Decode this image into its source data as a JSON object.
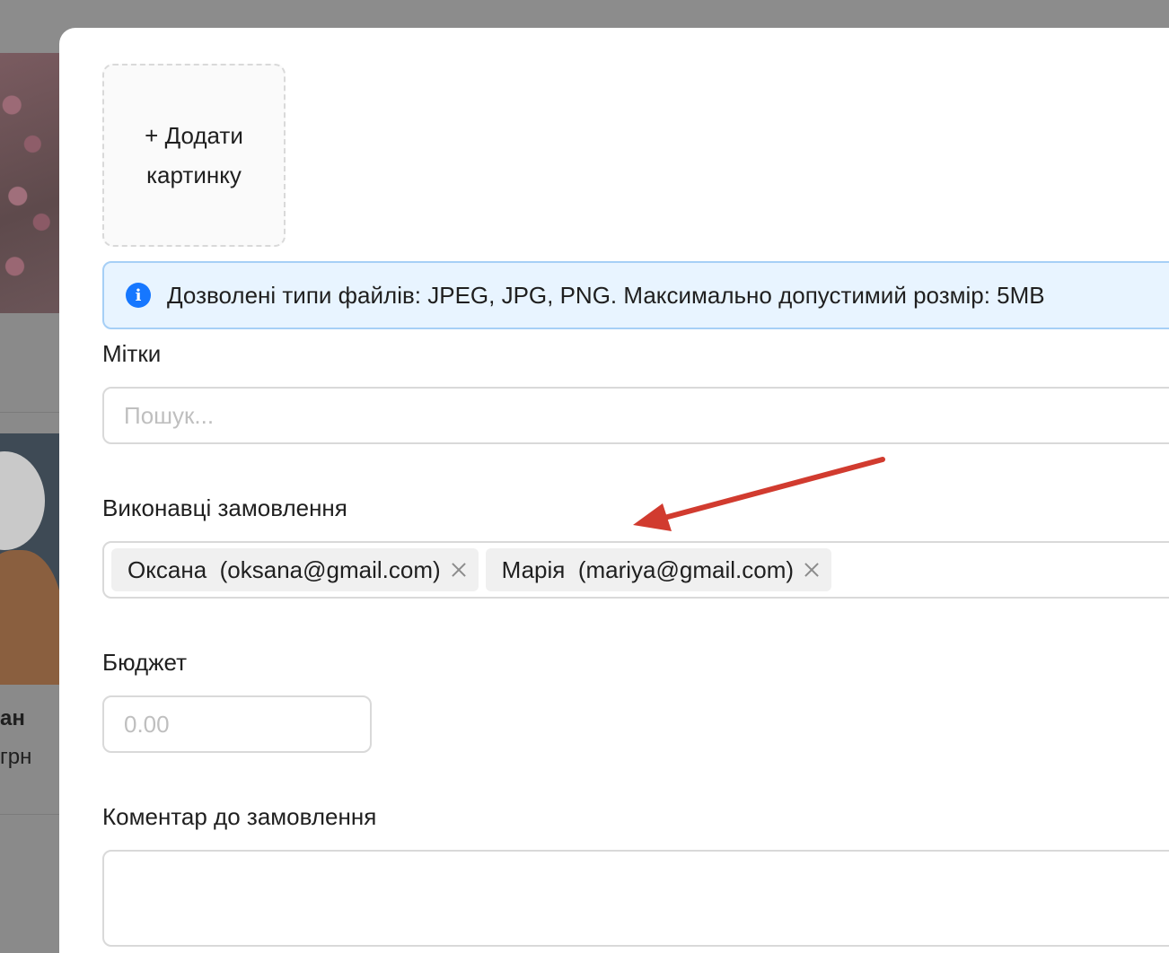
{
  "background": {
    "card_title": "ан",
    "card_price": "грн"
  },
  "upload": {
    "label": "+ Додати картинку"
  },
  "info_alert": {
    "icon": "info-icon",
    "icon_glyph": "i",
    "text": "Дозволені типи файлів: JPEG, JPG, PNG. Максимально допустимий розмір: 5MB",
    "color": "#1677ff"
  },
  "tags_field": {
    "label": "Мітки",
    "placeholder": "Пошук..."
  },
  "executors_field": {
    "label": "Виконавці замовлення",
    "selected": [
      "Оксана  (oksana@gmail.com)",
      "Марія  (mariya@gmail.com)"
    ]
  },
  "budget_field": {
    "label": "Бюджет",
    "placeholder": "0.00"
  },
  "comment_field": {
    "label": "Коментар до замовлення",
    "value": ""
  },
  "annotation": {
    "arrow_color": "#d13b2f"
  }
}
